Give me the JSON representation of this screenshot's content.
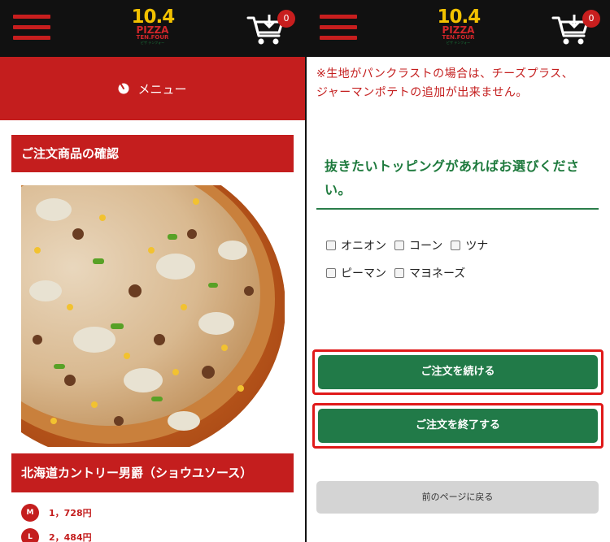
{
  "header": {
    "logo_number": "10.4",
    "logo_word": "PIZZA",
    "logo_subword": "TEN.FOUR",
    "logo_tagline": "ピザ テンフォー",
    "cart_count": "0"
  },
  "left": {
    "menu_label": "メニュー",
    "section_title": "ご注文商品の確認",
    "product_name": "北海道カントリー男爵（ショウユソース）",
    "prices": [
      {
        "size": "M",
        "price": "1，728円"
      },
      {
        "size": "L",
        "price": "2，484円"
      }
    ]
  },
  "right": {
    "notice": "※生地がパンクラストの場合は、チーズプラス、ジャーマンポテトの追加が出来ません。",
    "topping_title": "抜きたいトッピングがあればお選びください。",
    "toppings": [
      "オニオン",
      "コーン",
      "ツナ",
      "ピーマン",
      "マヨネーズ"
    ],
    "continue_button": "ご注文を続ける",
    "finish_button": "ご注文を終了する",
    "back_button": "前のページに戻る"
  },
  "colors": {
    "brand_red": "#c41e1e",
    "brand_green": "#217a48",
    "logo_yellow": "#f2c100",
    "highlight_red": "#e01919"
  }
}
